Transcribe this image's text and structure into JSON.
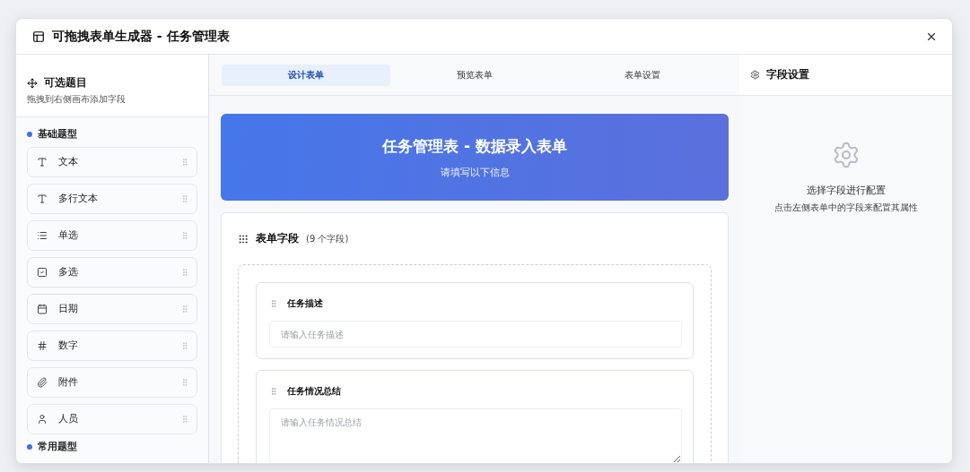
{
  "window": {
    "title": "可拖拽表单生成器 - 任务管理表"
  },
  "sidebar": {
    "title": "可选题目",
    "subtitle": "拖拽到右侧画布添加字段",
    "groups": [
      {
        "title": "基础题型",
        "items": [
          {
            "kind": "text",
            "label": "文本"
          },
          {
            "kind": "text",
            "label": "多行文本"
          },
          {
            "kind": "radio",
            "label": "单选"
          },
          {
            "kind": "checkbox",
            "label": "多选"
          },
          {
            "kind": "date",
            "label": "日期"
          },
          {
            "kind": "number",
            "label": "数字"
          },
          {
            "kind": "attachment",
            "label": "附件"
          },
          {
            "kind": "person",
            "label": "人员"
          }
        ]
      },
      {
        "title": "常用题型"
      }
    ]
  },
  "tabs": [
    {
      "label": "设计表单",
      "selected": true
    },
    {
      "label": "预览表单",
      "selected": false
    },
    {
      "label": "表单设置",
      "selected": false
    }
  ],
  "banner": {
    "title": "任务管理表 - 数据录入表单",
    "subtitle": "请填写以下信息"
  },
  "fields_card": {
    "title": "表单字段",
    "count": "(9 个字段)",
    "fields": [
      {
        "kind": "input",
        "label": "任务描述",
        "placeholder": "请输入任务描述"
      },
      {
        "kind": "textarea",
        "label": "任务情况总结",
        "placeholder": "请输入任务情况总结"
      }
    ]
  },
  "settings": {
    "title": "字段设置",
    "empty_title": "选择字段进行配置",
    "empty_hint": "点击左侧表单中的字段来配置其属性"
  }
}
